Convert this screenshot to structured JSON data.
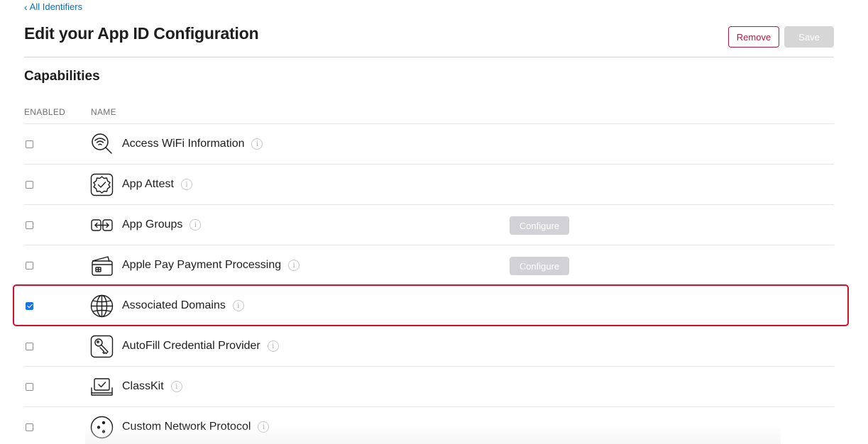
{
  "header": {
    "back_link": "All Identifiers",
    "title": "Edit your App ID Configuration",
    "remove_label": "Remove",
    "save_label": "Save"
  },
  "capabilities": {
    "section_title": "Capabilities",
    "col_enabled": "ENABLED",
    "col_name": "NAME",
    "configure_label": "Configure",
    "rows": [
      {
        "name": "Access WiFi Information",
        "enabled": false,
        "icon": "wifi-search-icon",
        "configure": false
      },
      {
        "name": "App Attest",
        "enabled": false,
        "icon": "seal-check-icon",
        "configure": false
      },
      {
        "name": "App Groups",
        "enabled": false,
        "icon": "app-groups-icon",
        "configure": true
      },
      {
        "name": "Apple Pay Payment Processing",
        "enabled": false,
        "icon": "wallet-cards-icon",
        "configure": true
      },
      {
        "name": "Associated Domains",
        "enabled": true,
        "icon": "globe-icon",
        "configure": false,
        "highlighted": true
      },
      {
        "name": "AutoFill Credential Provider",
        "enabled": false,
        "icon": "key-icon",
        "configure": false
      },
      {
        "name": "ClassKit",
        "enabled": false,
        "icon": "classkit-laptop-icon",
        "configure": false
      },
      {
        "name": "Custom Network Protocol",
        "enabled": false,
        "icon": "network-dots-icon",
        "configure": false
      }
    ]
  },
  "colors": {
    "link": "#0070c9",
    "remove": "#b51a3e",
    "highlight": "#d0112b",
    "checkbox_checked": "#1a73e8"
  }
}
